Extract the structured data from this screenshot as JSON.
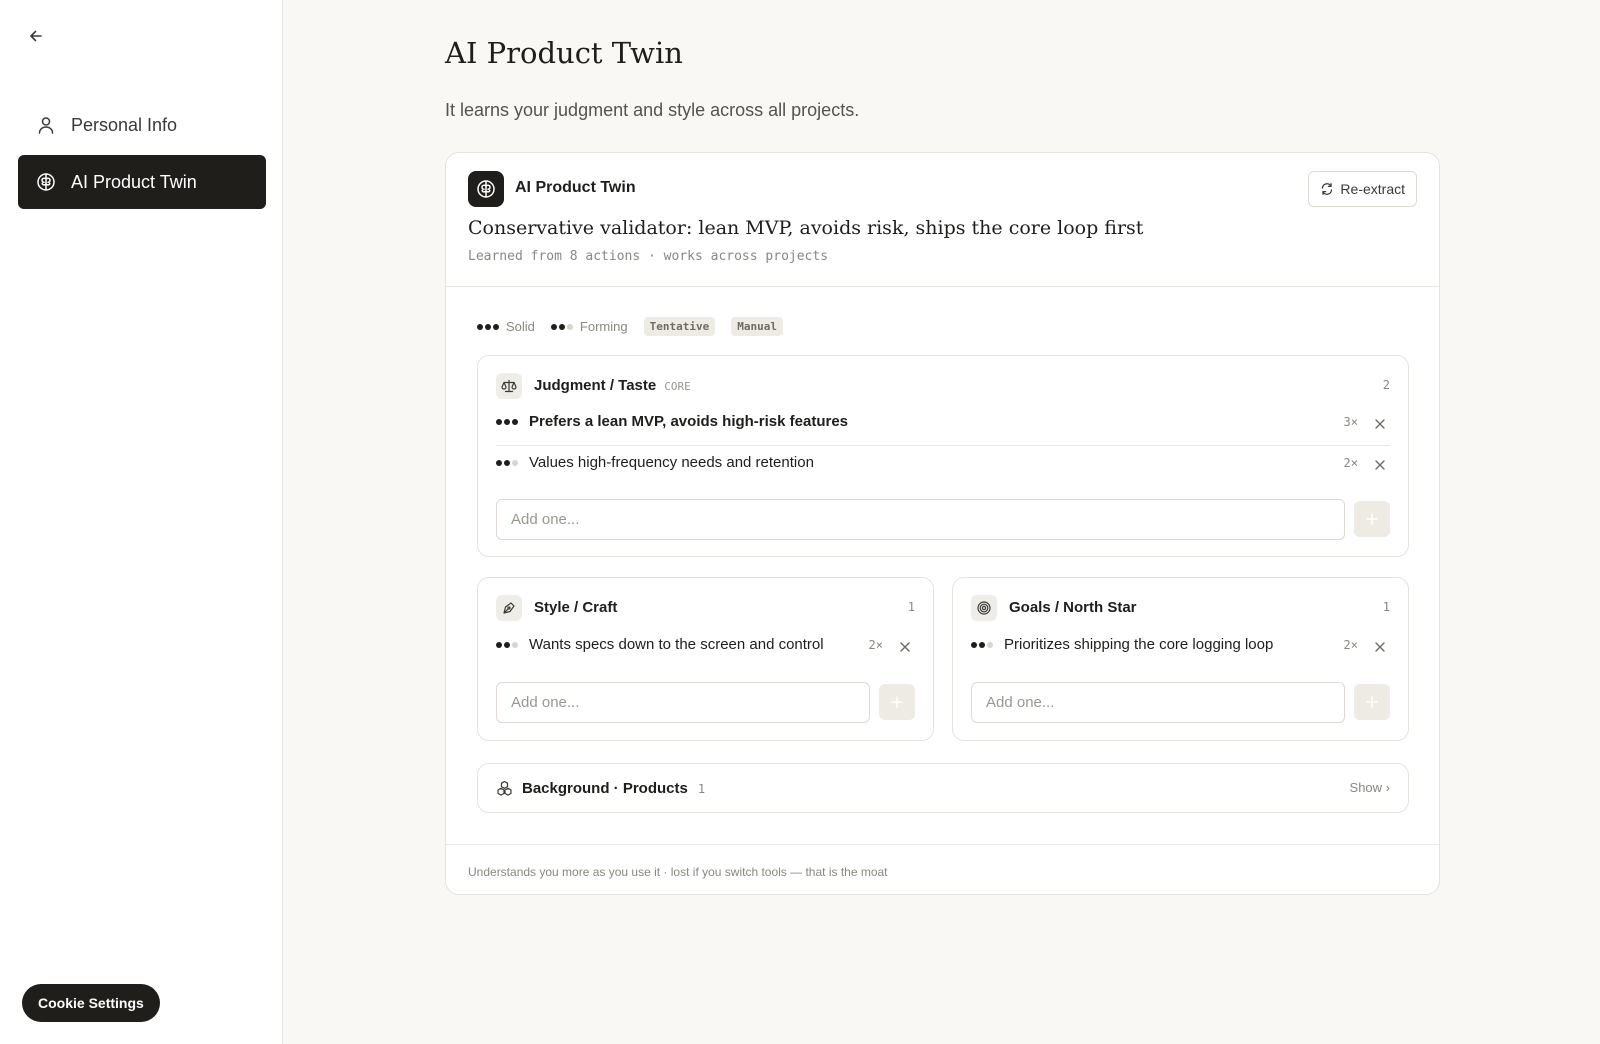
{
  "sidebar": {
    "items": [
      {
        "label": "Personal Info",
        "icon": "user-icon",
        "active": false
      },
      {
        "label": "AI Product Twin",
        "icon": "brain-icon",
        "active": true
      }
    ],
    "cookie_label": "Cookie Settings"
  },
  "main": {
    "title": "AI Product Twin",
    "subtitle": "It learns your judgment and style across all projects."
  },
  "card": {
    "brand_name": "AI Product Twin",
    "reextract_label": "Re-extract",
    "persona": "Conservative validator: lean MVP, avoids risk, ships the core loop first",
    "learned": "Learned from 8 actions · works across projects",
    "footer": "Understands you more as you use it · lost if you switch tools — that is the moat"
  },
  "legend": {
    "solid": "Solid",
    "forming": "Forming",
    "tentative": "Tentative",
    "manual": "Manual"
  },
  "sections": {
    "judgment": {
      "title": "Judgment / Taste",
      "tag": "CORE",
      "count": "2",
      "placeholder": "Add one...",
      "traits": [
        {
          "text": "Prefers a lean MVP, avoids high-risk features",
          "mult": "3×",
          "strength": 3
        },
        {
          "text": "Values high-frequency needs and retention",
          "mult": "2×",
          "strength": 2
        }
      ]
    },
    "style": {
      "title": "Style / Craft",
      "count": "1",
      "placeholder": "Add one...",
      "traits": [
        {
          "text": "Wants specs down to the screen and control",
          "mult": "2×",
          "strength": 2
        }
      ]
    },
    "goals": {
      "title": "Goals / North Star",
      "count": "1",
      "placeholder": "Add one...",
      "traits": [
        {
          "text": "Prioritizes shipping the core logging loop",
          "mult": "2×",
          "strength": 2
        }
      ]
    },
    "background": {
      "title": "Background · Products",
      "count": "1",
      "show_label": "Show ›"
    }
  },
  "colors": {
    "accent": "#1f1e1b",
    "background": "#f9f8f5",
    "muted": "#8a877f"
  }
}
